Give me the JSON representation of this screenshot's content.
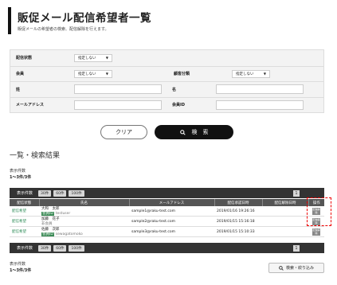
{
  "header": {
    "title": "販促メール配信希望者一覧",
    "subtitle": "販促メールの希望者の検索、配信解除を行えます。"
  },
  "form": {
    "status_label": "配信状態",
    "status_value": "指定しない",
    "member_label": "会員",
    "member_value": "指定しない",
    "customer_cat_label": "顧客分類",
    "customer_cat_value": "指定しない",
    "last_name_label": "姓",
    "first_name_label": "名",
    "email_label": "メールアドレス",
    "member_id_label": "会員ID"
  },
  "buttons": {
    "clear": "クリア",
    "search": "検　索",
    "filter": "検索・絞り込み"
  },
  "results": {
    "title": "一覧・検索結果",
    "count_label": "表示件数",
    "count_value": "1〜3件/3件",
    "pager_label": "表示件数",
    "page_sizes": [
      "30件",
      "60件",
      "100件"
    ],
    "page_number": "1"
  },
  "table": {
    "headers": [
      "配信状態",
      "氏名",
      "メールアドレス",
      "配信承認日時",
      "配信解除日時",
      "操作"
    ],
    "rows": [
      {
        "status": "配信希望",
        "name": "大和　太郎",
        "tag": "会員ID",
        "sub": "testuser",
        "email": "sample1@raku-test.com",
        "approved": "2019/01/16 19:26:16",
        "canceled": "",
        "op": "配信解除"
      },
      {
        "status": "配信希望",
        "name": "加藤　花子",
        "tag": "",
        "sub": "非会員",
        "email": "sample2@raku-test.com",
        "approved": "2019/01/15 15:16:18",
        "canceled": "",
        "op": "配信解除"
      },
      {
        "status": "配信希望",
        "name": "佐藤　次郎",
        "tag": "会員ID",
        "sub": "sewagatomoko",
        "email": "sample3@raku-test.com",
        "approved": "2019/01/15 15:10:33",
        "canceled": "",
        "op": "配信解除"
      }
    ]
  },
  "icons": {
    "search": "search-icon",
    "caret": "caret-down-icon"
  }
}
